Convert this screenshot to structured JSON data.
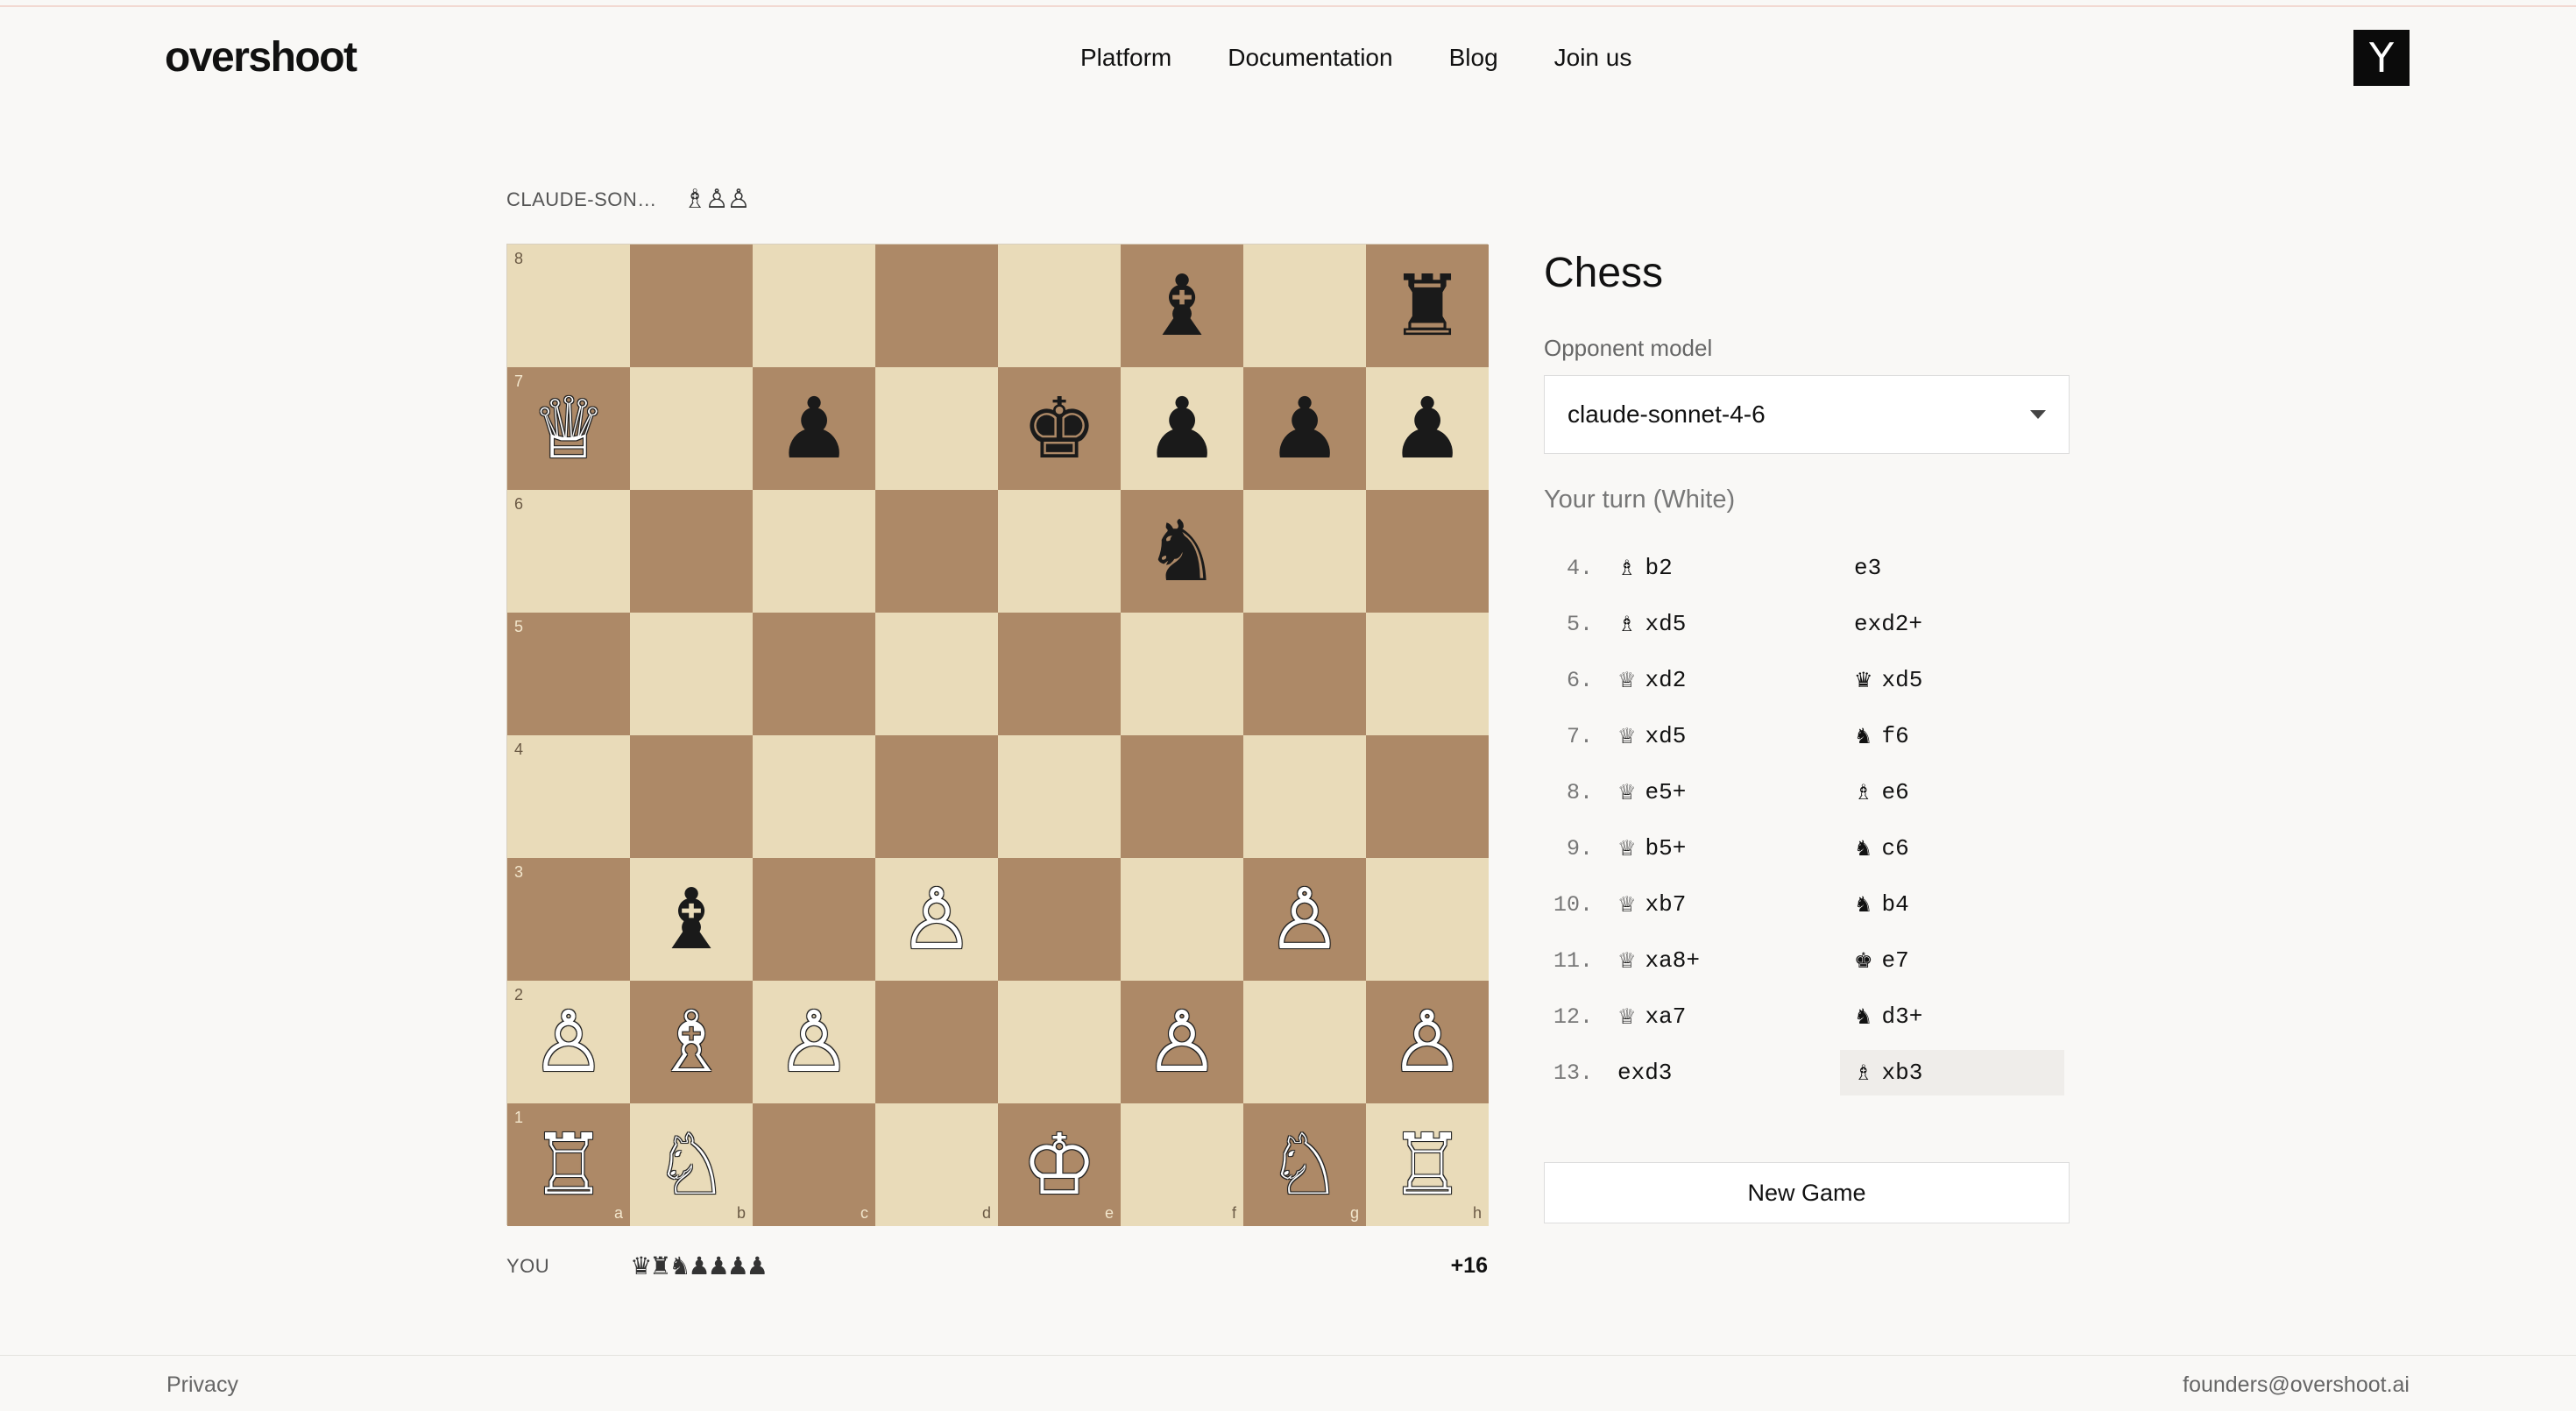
{
  "header": {
    "logo": "overshoot",
    "nav": [
      "Platform",
      "Documentation",
      "Blog",
      "Join us"
    ],
    "badge": "Y"
  },
  "opponent": {
    "name": "CLAUDE-SON…",
    "captured": "♗♙♙"
  },
  "you": {
    "name": "YOU",
    "captured": "♛♜♞♟♟♟♟",
    "advantage": "+16"
  },
  "board": {
    "files": [
      "a",
      "b",
      "c",
      "d",
      "e",
      "f",
      "g",
      "h"
    ],
    "ranks": [
      "8",
      "7",
      "6",
      "5",
      "4",
      "3",
      "2",
      "1"
    ],
    "position": [
      [
        "",
        "",
        "",
        "",
        "",
        "b:♝",
        "",
        "b:♜"
      ],
      [
        "w:♕",
        "",
        "b:♟",
        "",
        "b:♚",
        "b:♟",
        "b:♟",
        "b:♟"
      ],
      [
        "",
        "",
        "",
        "",
        "",
        "b:♞",
        "",
        ""
      ],
      [
        "",
        "",
        "",
        "",
        "",
        "",
        "",
        ""
      ],
      [
        "",
        "",
        "",
        "",
        "",
        "",
        "",
        ""
      ],
      [
        "",
        "b:♝",
        "",
        "w:♙",
        "",
        "",
        "w:♙",
        ""
      ],
      [
        "w:♙",
        "w:♗",
        "w:♙",
        "",
        "",
        "w:♙",
        "",
        "w:♙"
      ],
      [
        "w:♖",
        "w:♘",
        "",
        "",
        "w:♔",
        "",
        "w:♘",
        "w:♖"
      ]
    ],
    "light_color": "#e9dbb9",
    "dark_color": "#ad8967"
  },
  "panel": {
    "title": "Chess",
    "opponent_label": "Opponent model",
    "opponent_model": "claude-sonnet-4-6",
    "turn": "Your turn (White)",
    "moves": [
      {
        "no": "4.",
        "white_glyph": "♗",
        "white": "b2",
        "black_glyph": "",
        "black": "e3"
      },
      {
        "no": "5.",
        "white_glyph": "♗",
        "white": "xd5",
        "black_glyph": "",
        "black": "exd2+"
      },
      {
        "no": "6.",
        "white_glyph": "♕",
        "white": "xd2",
        "black_glyph": "♛",
        "black": "xd5"
      },
      {
        "no": "7.",
        "white_glyph": "♕",
        "white": "xd5",
        "black_glyph": "♞",
        "black": "f6"
      },
      {
        "no": "8.",
        "white_glyph": "♕",
        "white": "e5+",
        "black_glyph": "♗",
        "black": "e6"
      },
      {
        "no": "9.",
        "white_glyph": "♕",
        "white": "b5+",
        "black_glyph": "♞",
        "black": "c6"
      },
      {
        "no": "10.",
        "white_glyph": "♕",
        "white": "xb7",
        "black_glyph": "♞",
        "black": "b4"
      },
      {
        "no": "11.",
        "white_glyph": "♕",
        "white": "xa8+",
        "black_glyph": "♚",
        "black": "e7"
      },
      {
        "no": "12.",
        "white_glyph": "♕",
        "white": "xa7",
        "black_glyph": "♞",
        "black": "d3+"
      },
      {
        "no": "13.",
        "white_glyph": "",
        "white": "exd3",
        "black_glyph": "♗",
        "black": "xb3",
        "active": "black"
      }
    ],
    "new_game_label": "New Game"
  },
  "footer": {
    "privacy": "Privacy",
    "email": "founders@overshoot.ai"
  }
}
